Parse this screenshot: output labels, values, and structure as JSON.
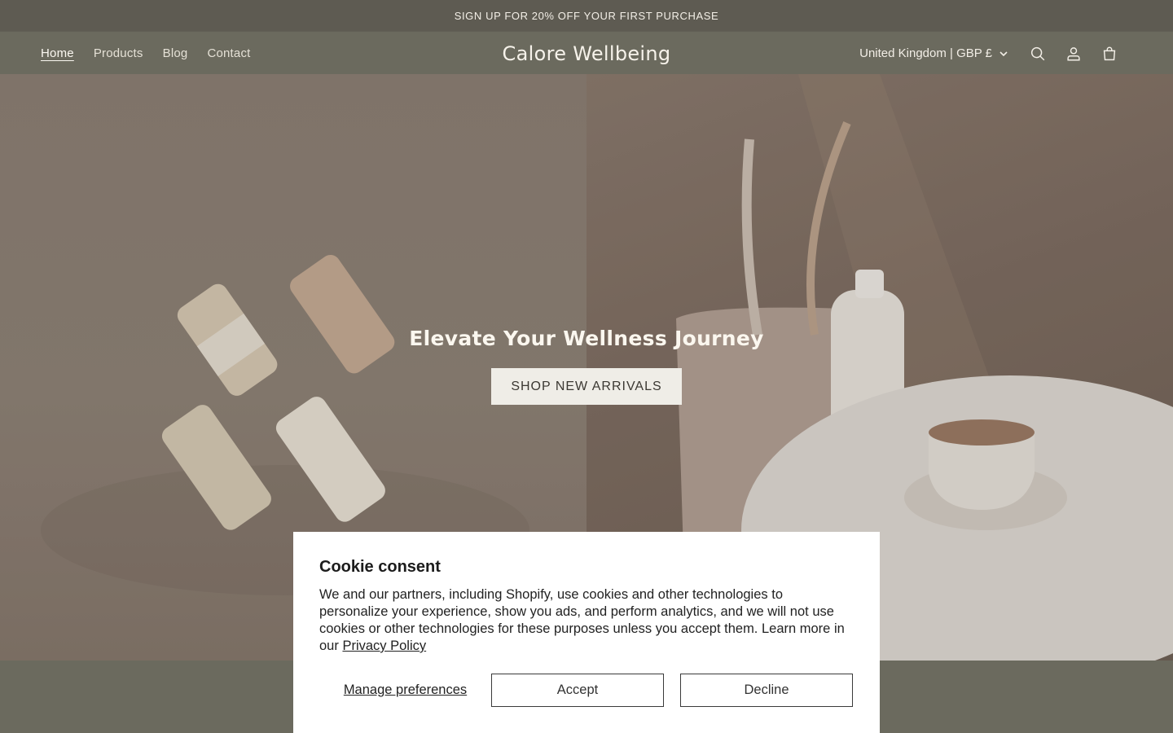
{
  "announcement": {
    "text": "SIGN UP FOR 20% OFF YOUR FIRST PURCHASE"
  },
  "header": {
    "nav": [
      {
        "label": "Home",
        "active": true
      },
      {
        "label": "Products"
      },
      {
        "label": "Blog"
      },
      {
        "label": "Contact"
      }
    ],
    "brand": "Calore Wellbeing",
    "country_selector": "United Kingdom | GBP £",
    "icons": [
      "search-icon",
      "account-icon",
      "cart-icon"
    ]
  },
  "hero": {
    "title": "Elevate Your Wellness Journey",
    "cta": "SHOP NEW ARRIVALS"
  },
  "cookie": {
    "title": "Cookie consent",
    "body": "We and our partners, including Shopify, use cookies and other technologies to personalize your experience, show you ads, and perform analytics, and we will not use cookies or other technologies for these purposes unless you accept them. Learn more in our",
    "privacy_link": "Privacy Policy",
    "manage": "Manage preferences",
    "accept": "Accept",
    "decline": "Decline"
  },
  "colors": {
    "header_bg": "#6b6a5e",
    "announcement_bg": "#5e5b52",
    "cta_bg": "#efede7",
    "modal_bg": "#ffffff"
  }
}
